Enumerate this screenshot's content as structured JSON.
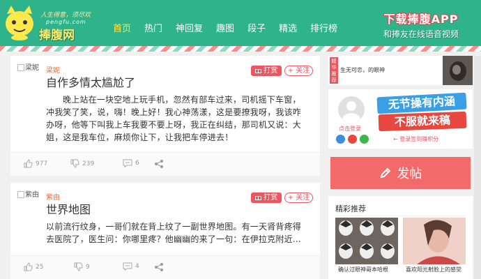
{
  "header": {
    "logo": {
      "tagline": "人生得意，须尽欢",
      "url": "pengfu.com",
      "name": "捧腹网"
    },
    "nav": [
      "首页",
      "热门",
      "神回复",
      "趣图",
      "段子",
      "精选",
      "排行榜"
    ],
    "active_nav": "首页",
    "app_banner": {
      "title": "下载捧腹APP",
      "subtitle": "和捧友在线语音视频"
    }
  },
  "posts": [
    {
      "avatar_alt": "梁妮",
      "author": "梁妮",
      "reward_label": "打赏",
      "follow_label": "+ 关注",
      "title": "自作多情太尴尬了",
      "body": "晚上站在一块空地上玩手机，忽然有部车过来，司机摇下车窗，冲我笑了笑，说，嗨！晚上好！我心神荡漾，这是要撩我呀，我该咋办呀，他等下叫我上车我要不要上呀，我正在纠结，那司机又说：大姐，这是我车位，麻烦你让下，让我把车停进去！",
      "likes": "977",
      "dislikes": "239",
      "comments": "6"
    },
    {
      "avatar_alt": "紫由",
      "author": "紫由",
      "reward_label": "打赏",
      "follow_label": "+ 关注",
      "title": "世界地图",
      "body": "以前流行纹身，一哥们就在背上纹了一副世界地图。有一天肾背疼得去医院了，医生问：你哪里疼？他幽幽的来了一句：在伊拉克附近…",
      "likes": "25",
      "dislikes": "9",
      "comments": "4"
    }
  ],
  "sidebar": {
    "recommend_tag": "精华推荐",
    "recommend_text": "生无可恋，的眼神",
    "login_link": "点击登录",
    "promo_line1": "无节操有内涵",
    "promo_line2": "不服就来稿",
    "signin_link": "← 登录签到赚积分",
    "post_button": "发帖",
    "featured_title": "精彩推荐",
    "featured": [
      {
        "caption": "确认过眼神哥本哈根"
      },
      {
        "caption": "喜欢阳光射脸上的感觉"
      }
    ]
  },
  "colors": {
    "header_green": "#2fb38a",
    "accent_red": "#ec5661",
    "nav_active": "#ffe84a",
    "post_button": "#f26a6a"
  }
}
